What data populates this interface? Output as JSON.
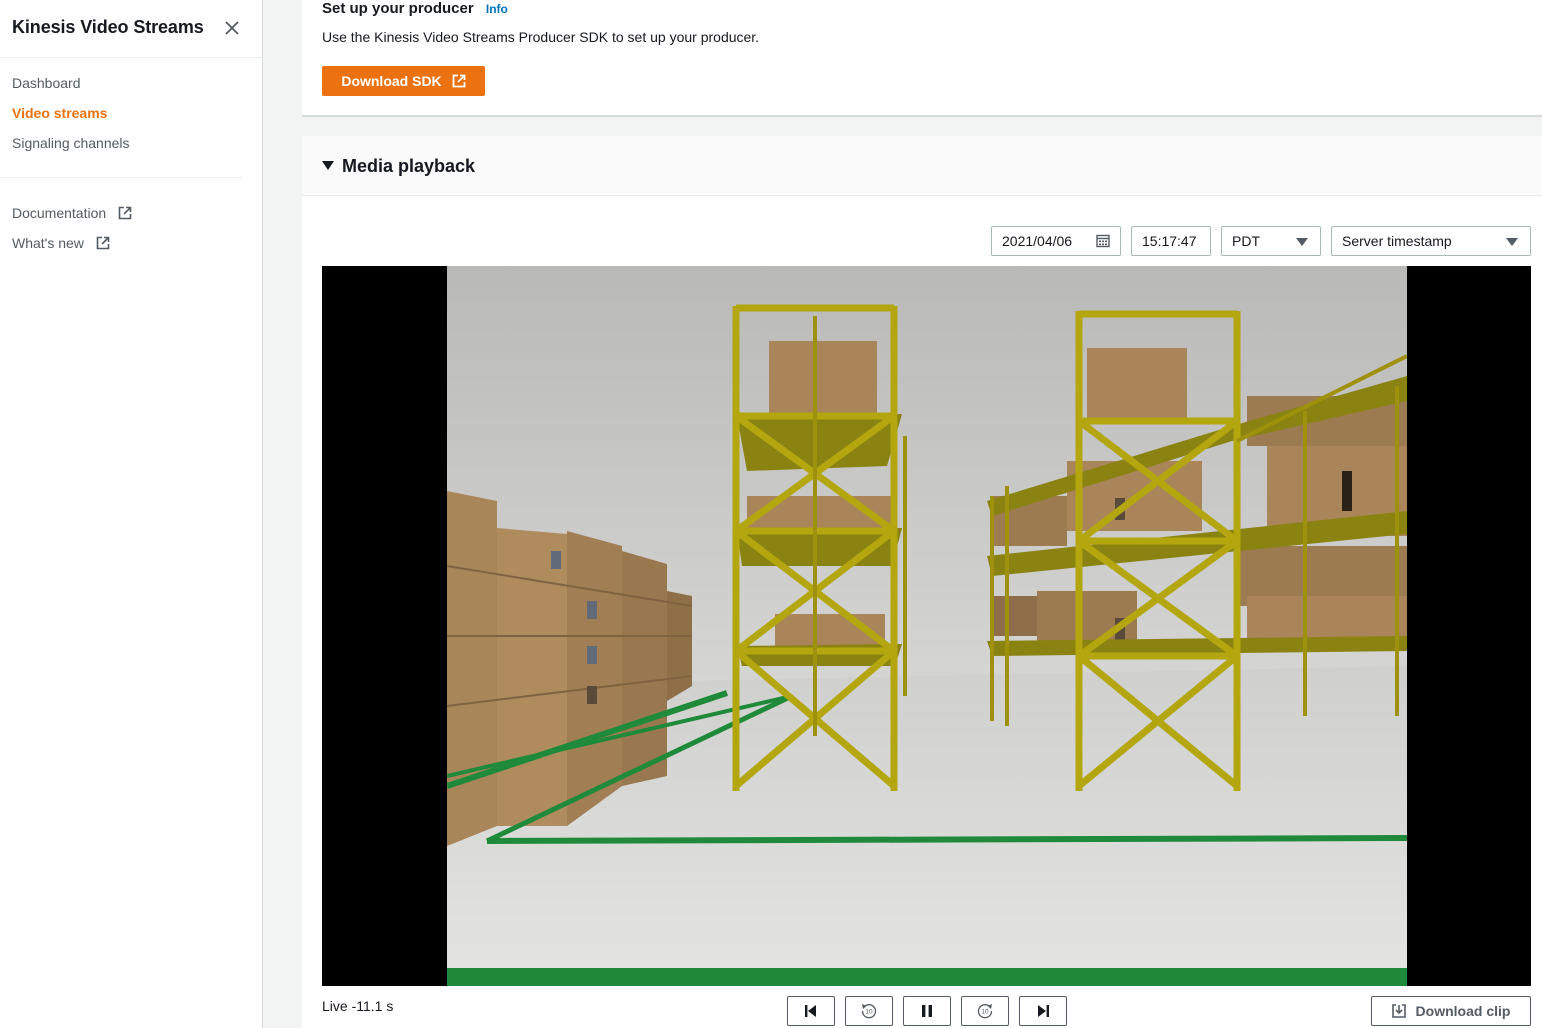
{
  "sidebar": {
    "title": "Kinesis Video Streams",
    "close_icon": "close-icon",
    "items": [
      {
        "label": "Dashboard",
        "active": false
      },
      {
        "label": "Video streams",
        "active": true
      },
      {
        "label": "Signaling channels",
        "active": false
      }
    ],
    "links": [
      {
        "label": "Documentation",
        "icon": "external-link-icon"
      },
      {
        "label": "What's new",
        "icon": "external-link-icon"
      }
    ]
  },
  "producer": {
    "title": "Set up your producer",
    "info": "Info",
    "description": "Use the Kinesis Video Streams Producer SDK to set up your producer.",
    "download_sdk_label": "Download SDK"
  },
  "media": {
    "title": "Media playback",
    "date": "2021/04/06",
    "time": "15:17:47",
    "timezone": "PDT",
    "timestamp_type": "Server timestamp",
    "live_status": "Live -11.1 s",
    "download_clip_label": "Download clip",
    "player_controls": [
      "skip-to-start-icon",
      "rewind-10-icon",
      "pause-icon",
      "forward-10-icon",
      "skip-to-end-icon"
    ],
    "rewind_seconds": "10",
    "forward_seconds": "10"
  },
  "colors": {
    "accent": "#ec7211",
    "link": "#0073bb",
    "text": "#16191f",
    "muted": "#545b64"
  }
}
